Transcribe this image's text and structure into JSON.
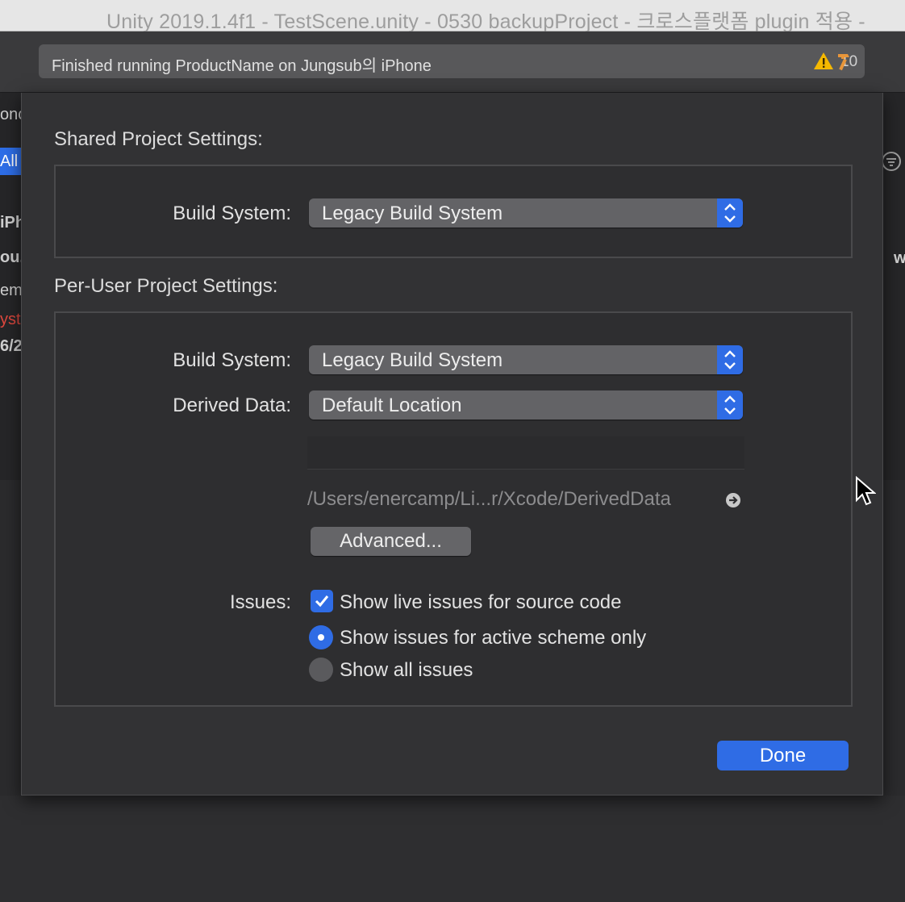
{
  "window": {
    "title": "Unity 2019.1.4f1 - TestScene.unity - 0530 backupProject - 크로스플랫폼 plugin 적용 -"
  },
  "toolbar": {
    "activity_message": "Finished running ProductName on Jungsub의 iPhone",
    "warning_count": "10"
  },
  "background": {
    "left_fragments": [
      "onc",
      "iPh",
      "ou.",
      "em",
      "yst",
      "6/2"
    ],
    "all_tab": "All",
    "right_fragment": "w"
  },
  "sheet": {
    "shared_title": "Shared Project Settings:",
    "shared_build_system_label": "Build System:",
    "shared_build_system_value": "Legacy Build System",
    "peruser_title": "Per-User Project Settings:",
    "peruser_build_system_label": "Build System:",
    "peruser_build_system_value": "Legacy Build System",
    "derived_data_label": "Derived Data:",
    "derived_data_value": "Default Location",
    "derived_data_path": "/Users/enercamp/Li...r/Xcode/DerivedData",
    "advanced_button": "Advanced...",
    "issues_label": "Issues:",
    "option_live_issues": "Show live issues for source code",
    "option_active_scheme": "Show issues for active scheme only",
    "option_all_issues": "Show all issues",
    "done_button": "Done"
  },
  "colors": {
    "accent": "#2f6ce5",
    "sheet_background": "#323234",
    "warning": "#f5b800",
    "error_text": "#e0483e"
  }
}
